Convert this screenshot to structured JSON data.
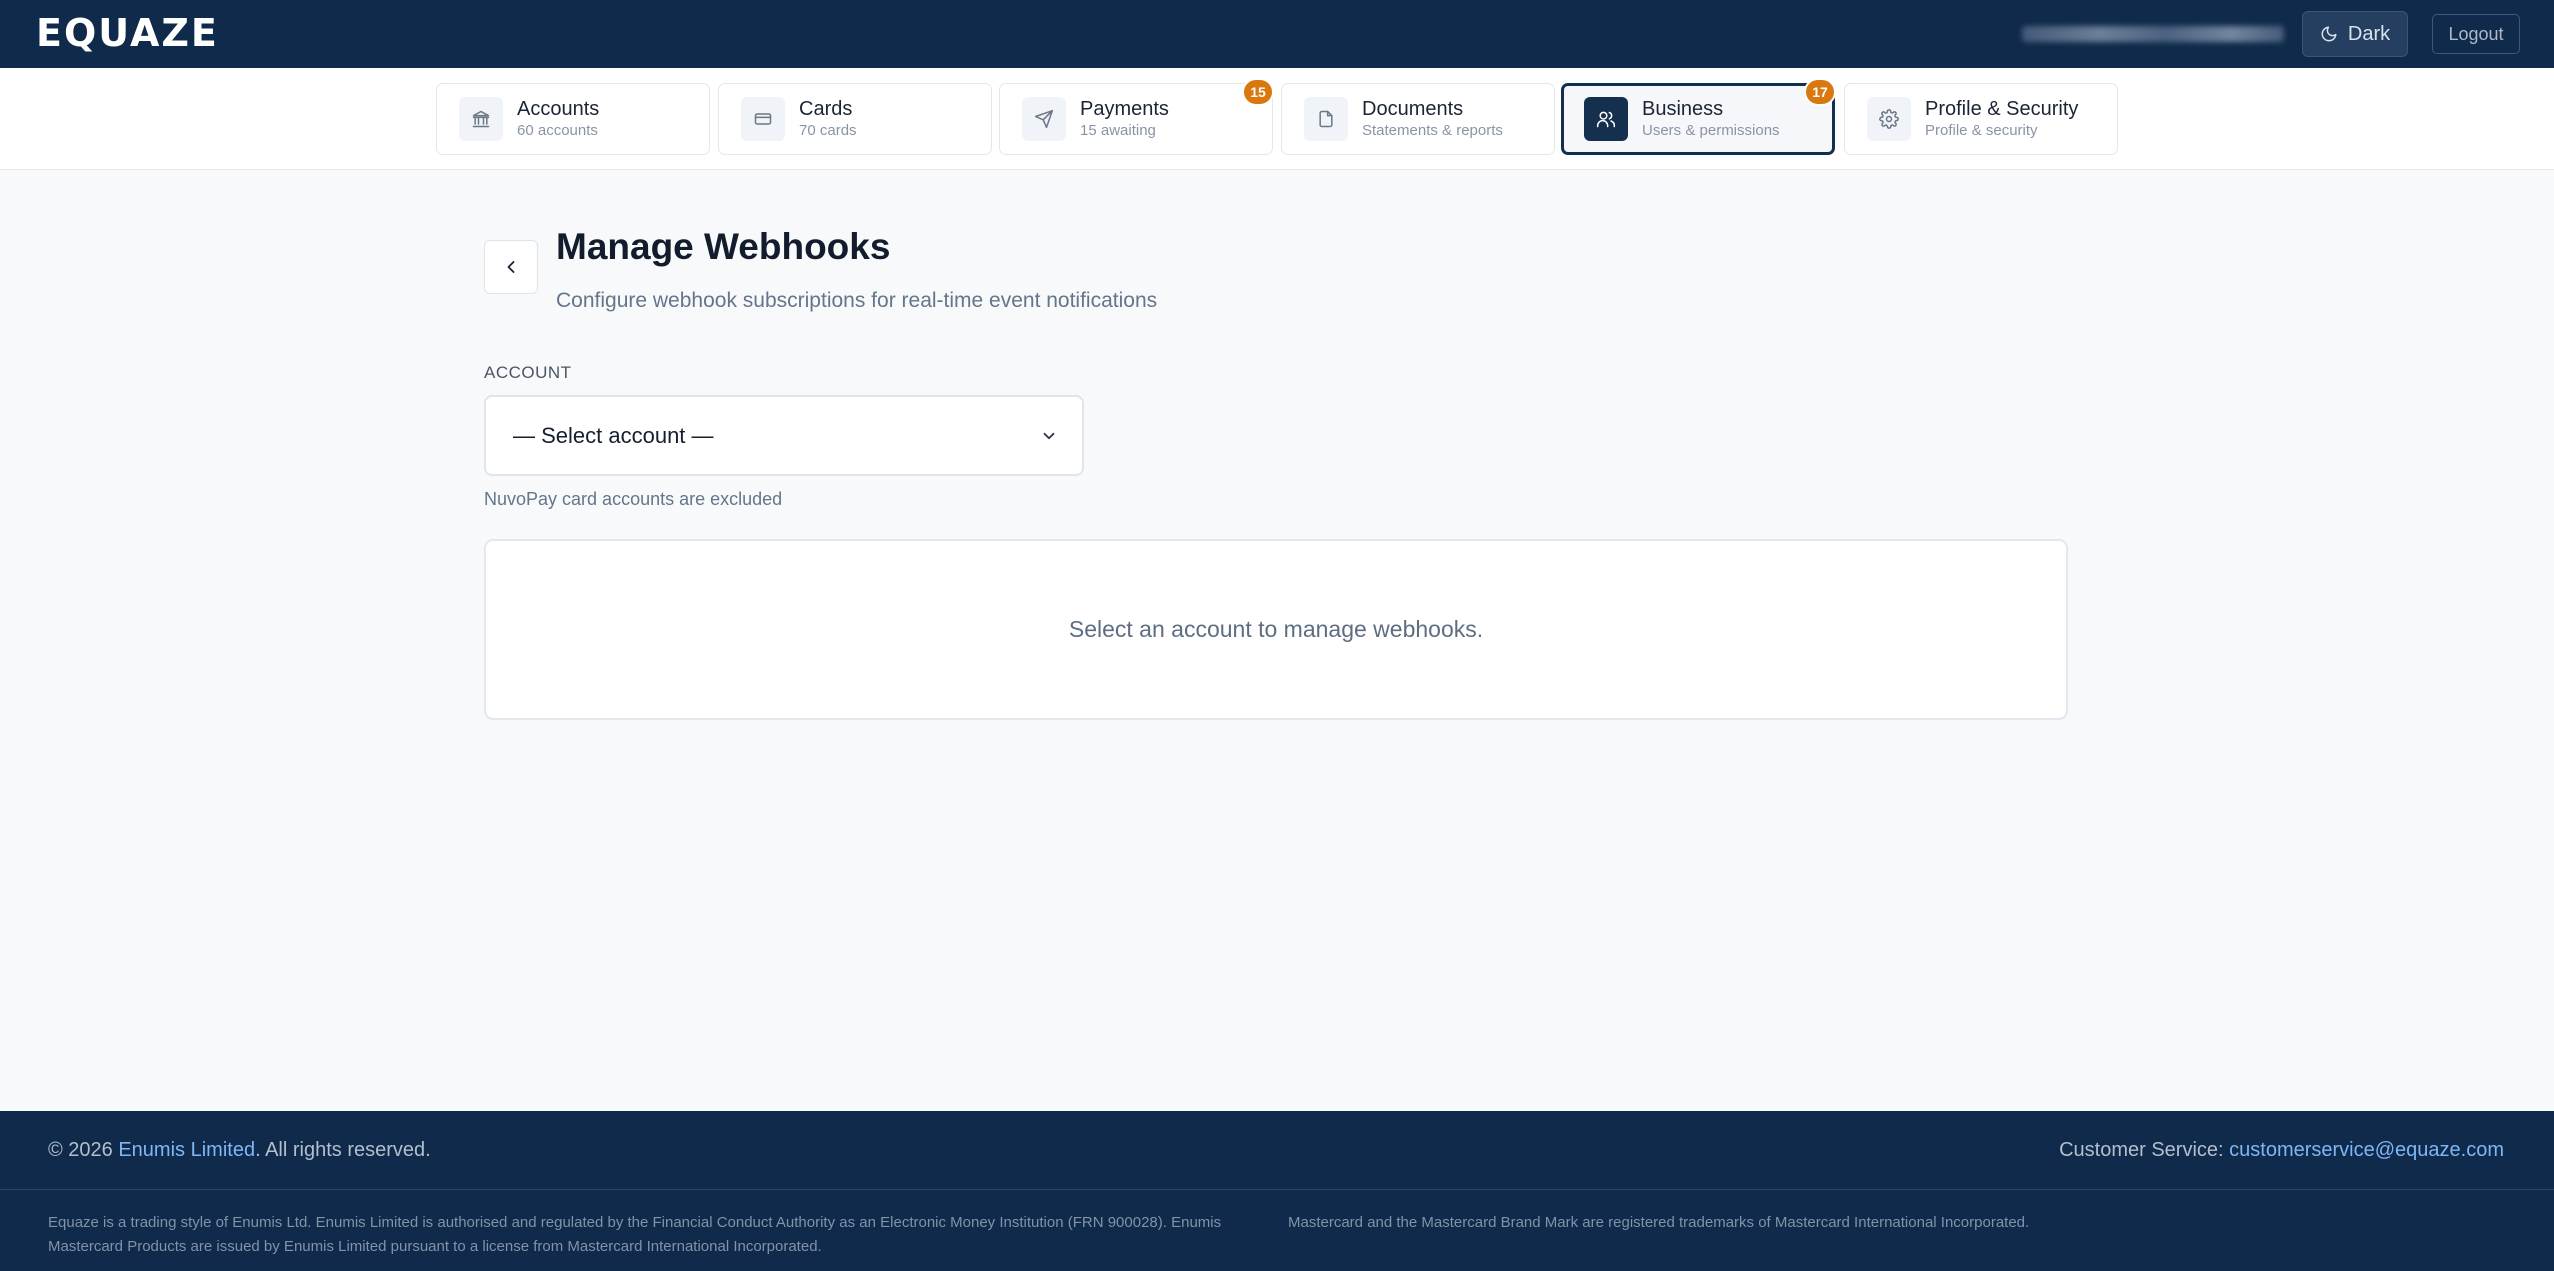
{
  "app": {
    "logo": "EQUAZE",
    "theme_toggle_label": "Dark",
    "logout_label": "Logout"
  },
  "nav": {
    "tabs": [
      {
        "title": "Accounts",
        "subtitle": "60 accounts",
        "icon": "bank-icon",
        "badge": null
      },
      {
        "title": "Cards",
        "subtitle": "70 cards",
        "icon": "credit-card-icon",
        "badge": null
      },
      {
        "title": "Payments",
        "subtitle": "15 awaiting",
        "icon": "send-icon",
        "badge": "15"
      },
      {
        "title": "Documents",
        "subtitle": "Statements & reports",
        "icon": "document-icon",
        "badge": null
      },
      {
        "title": "Business",
        "subtitle": "Users & permissions",
        "icon": "users-icon",
        "badge": "17",
        "active": true
      },
      {
        "title": "Profile & Security",
        "subtitle": "Profile & security",
        "icon": "gear-icon",
        "badge": null
      }
    ]
  },
  "main": {
    "title": "Manage Webhooks",
    "subtitle": "Configure webhook subscriptions for real-time event notifications",
    "account_label": "ACCOUNT",
    "account_select_value": "— Select account —",
    "account_hint": "NuvoPay card accounts are excluded",
    "empty_message": "Select an account to manage webhooks."
  },
  "footer": {
    "copyright_prefix": "© 2026 ",
    "company_link": "Enumis Limited",
    "copyright_suffix": ". All rights reserved.",
    "customer_service_label": "Customer Service: ",
    "customer_service_email": "customerservice@equaze.com",
    "legal_left": "Equaze is a trading style of Enumis Ltd. Enumis Limited is authorised and regulated by the Financial Conduct Authority as an Electronic Money Institution (FRN 900028). Enumis Mastercard Products are issued by Enumis Limited pursuant to a license from Mastercard International Incorporated.",
    "legal_right": "Mastercard and the Mastercard Brand Mark are registered trademarks of Mastercard International Incorporated."
  },
  "colors": {
    "header_bg": "#0f2a4a",
    "badge": "#d9780f",
    "link": "#7fb6f5",
    "page_bg": "#f7f9fb"
  }
}
